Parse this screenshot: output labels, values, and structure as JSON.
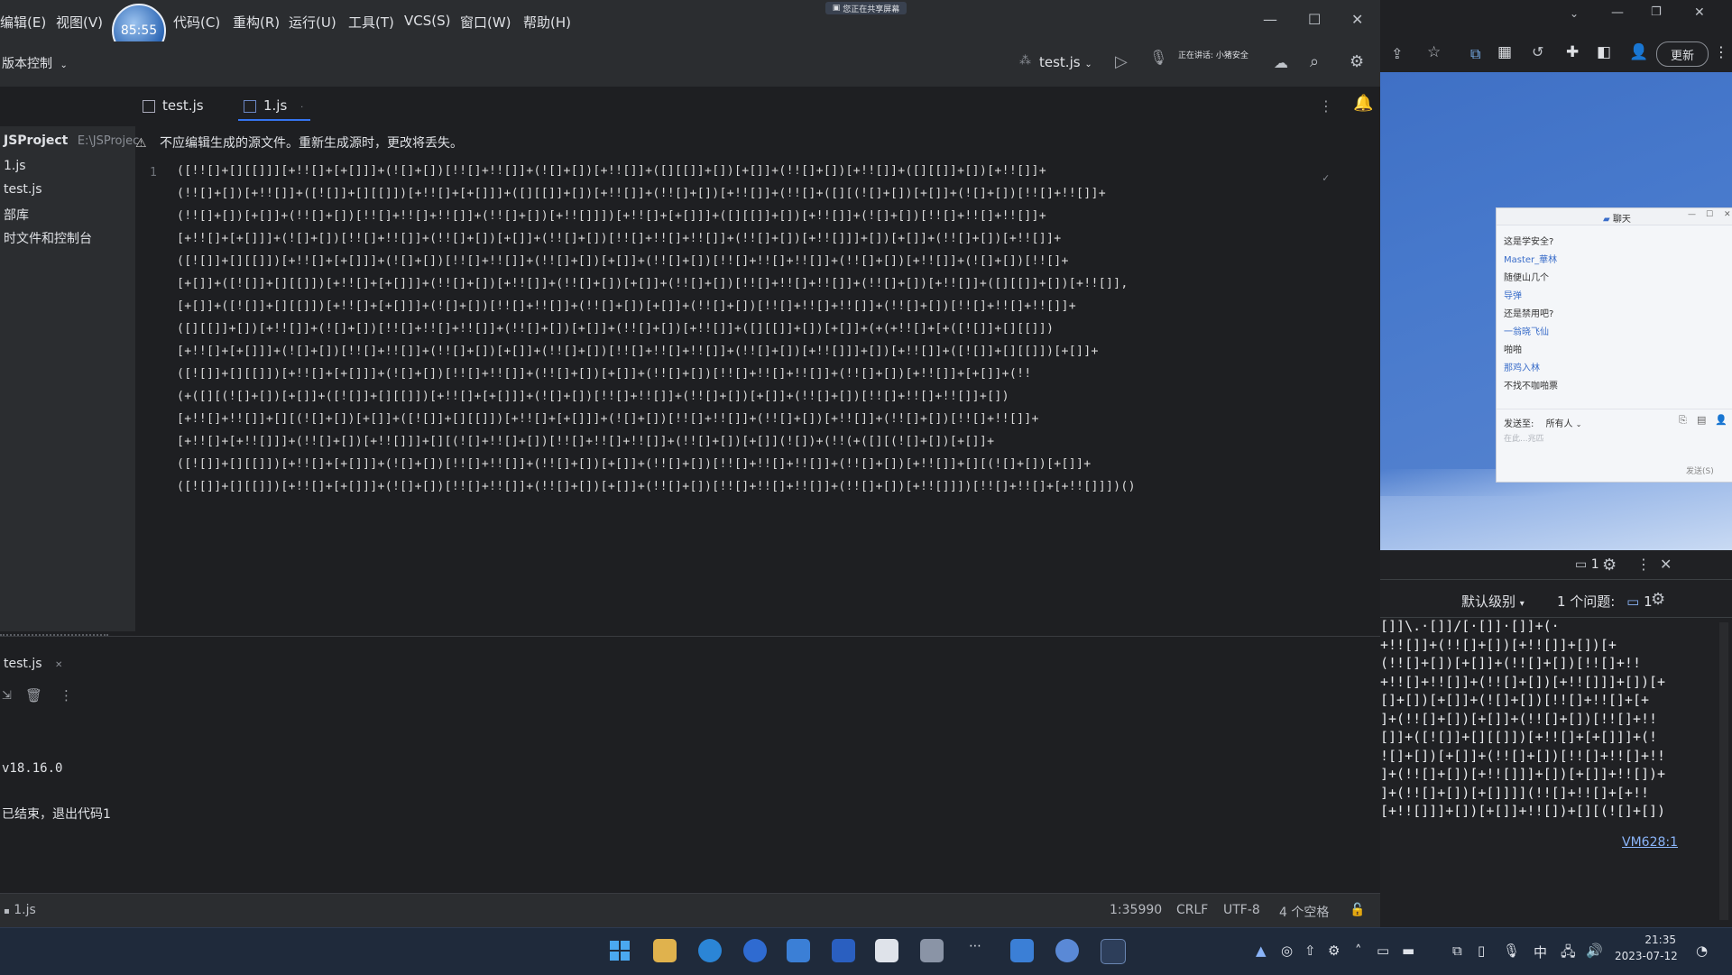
{
  "menu": {
    "items": [
      "编辑(E)",
      "视图(V)",
      "代码(C)",
      "重构(R)",
      "运行(U)",
      "工具(T)",
      "VCS(S)",
      "窗口(W)",
      "帮助(H)"
    ],
    "timer": "85:55",
    "share_badge": "您正在共享屏幕"
  },
  "toolbar": {
    "vcs_label": "版本控制",
    "run_config": "test.js",
    "speaking_label": "正在讲话:",
    "speaker_name": "小猪安全"
  },
  "tabs": [
    {
      "label": "test.js"
    },
    {
      "label": "1.js"
    }
  ],
  "project": {
    "root_label": "JSProject",
    "root_path": "E:\\JSProjec",
    "items": [
      "1.js",
      "test.js",
      "部库",
      "时文件和控制台"
    ]
  },
  "banner": {
    "text": "不应编辑生成的源文件。重新生成源时，更改将丢失。"
  },
  "editor": {
    "line_number": "1",
    "lines": [
      "([!![]+[][[]]][+!![]+[+[]]]+(![]+[])[!![]+!![]]+(![]+[])[+!![]]+([][[]]+[])[+[]]+(!![]+[])[+!![]]+([][[]]+[])[+!![]]+",
      "(!![]+[])[+!![]]+([![]]+[][[]])[+!![]+[+[]]]+([][[]]+[])[+!![]]+(!![]+[])[+!![]]+(!![]+([][(![]+[])[+[]]+(![]+[])[!![]+!![]]+",
      "(!![]+[])[+[]]+(!![]+[])[!![]+!![]+!![]]+(!![]+[])[+!![]]])[+!![]+[+[]]]+([][[]]+[])[+!![]]+(![]+[])[!![]+!![]+!![]]+",
      "[+!![]+[+[]]]+(![]+[])[!![]+!![]]+(!![]+[])[+[]]+(!![]+[])[!![]+!![]+!![]]+(!![]+[])[+!![]]]+[])[+[]]+(!![]+[])[+!![]]+",
      "([![]]+[][[]])[+!![]+[+[]]]+(![]+[])[!![]+!![]]+(!![]+[])[+[]]+(!![]+[])[!![]+!![]+!![]]+(!![]+[])[+!![]]+(![]+[])[!![]+",
      "[+[]]+([![]]+[][[]])[+!![]+[+[]]]+(!![]+[])[+!![]]+(!![]+[])[+[]]+(!![]+[])[!![]+!![]+!![]]+(!![]+[])[+!![]]+([][[]]+[])[+!![]],",
      "[+[]]+([![]]+[][[]])[+!![]+[+[]]]+(![]+[])[!![]+!![]]+(!![]+[])[+[]]+(!![]+[])[!![]+!![]+!![]]+(!![]+[])[!![]+!![]+!![]]+",
      "([][[]]+[])[+!![]]+(![]+[])[!![]+!![]+!![]]+(!![]+[])[+[]]+(!![]+[])[+!![]]+([][[]]+[])[+[]]+(+(+!![]+[+([![]]+[][[]])",
      "[+!![]+[+[]]]+(![]+[])[!![]+!![]]+(!![]+[])[+[]]+(!![]+[])[!![]+!![]+!![]]+(!![]+[])[+!![]]]+[])[+!![]]+([![]]+[][[]])[+[]]+",
      "([![]]+[][[]])[+!![]+[+[]]]+(![]+[])[!![]+!![]]+(!![]+[])[+[]]+(!![]+[])[!![]+!![]+!![]]+(!![]+[])[+!![]]+[+[]]+(!!",
      "(+([][(![]+[])[+[]]+([![]]+[][[]])[+!![]+[+[]]]+(![]+[])[!![]+!![]]+(!![]+[])[+[]]+(!![]+[])[!![]+!![]+!![]]+[])",
      "[+!![]+!![]]+[][(![]+[])[+[]]+([![]]+[][[]])[+!![]+[+[]]]+(![]+[])[!![]+!![]]+(!![]+[])[+!![]]+(!![]+[])[!![]+!![]]+",
      "[+!![]+[+!![]]]+(!![]+[])[+!![]]]+[][(![]+!![]+[])[!![]+!![]+!![]]+(!![]+[])[+[]](![])+(!!(+([][(![]+[])[+[]]+",
      "([![]]+[][[]])[+!![]+[+[]]]+(![]+[])[!![]+!![]]+(!![]+[])[+[]]+(!![]+[])[!![]+!![]+!![]]+(!![]+[])[+!![]]+[][(![]+[])[+[]]+",
      "([![]]+[][[]])[+!![]+[+[]]]+(![]+[])[!![]+!![]]+(!![]+[])[+[]]+(!![]+[])[!![]+!![]+!![]]+(!![]+[])[+!![]]])[!![]+!![]+[+!![]]])()"
    ]
  },
  "bottom_panel": {
    "tab_label": "test.js",
    "node_version": "v18.16.0",
    "exit_text": "已结束，退出代码1"
  },
  "status": {
    "file": "1.js",
    "position": "1:35990",
    "line_sep": "CRLF",
    "encoding": "UTF-8",
    "indent": "4 个空格"
  },
  "browser": {
    "update_button": "更新",
    "chat": {
      "title": "聊天",
      "messages": [
        "这是学安全?",
        "Master_華林",
        "随便山几个",
        "导弹",
        "还是禁用吧?",
        "一翁晓飞仙",
        "啪啪",
        "那鸡入林",
        "不找不咖啪票"
      ],
      "send_to_label": "发送至:",
      "send_to_value": "所有人",
      "input_placeholder": "在此...兆匹",
      "send_button": "发送(S)"
    },
    "devtools": {
      "issues_count": "1",
      "level_label": "默认级别",
      "issues_label": "1 个问题:",
      "issues_badge": "1",
      "code_lines": [
        "[]]\\.·[]]/[·[]]·[]]+(·",
        "+!![]]+(!![]+[])[+!![]]+[])[+",
        "(!![]+[])[+[]]+(!![]+[])[!![]+!!",
        "+!![]+!![]]+(!![]+[])[+!![]]]+[])[+",
        "[]+[])[+[]]+(![]+[])[!![]+!![]+[+",
        "]+(!![]+[])[+[]]+(!![]+[])[!![]+!!",
        "[]]+([![]]+[][[]])[+!![]+[+[]]]+(!",
        "![]+[])[+[]]+(!![]+[])[!![]+!![]+!!",
        "]+(!![]+[])[+!![]]]+[])[+[]]+!![])+",
        "]+(!![]+[])[+[]]]](!![]+!![]+[+!!",
        "[+!![]]]+[])[+[]]+!![])+[][(![]+[])"
      ],
      "link": "VM628:1"
    }
  },
  "taskbar": {
    "time": "21:35",
    "date": "2023-07-12",
    "ime": "中"
  }
}
